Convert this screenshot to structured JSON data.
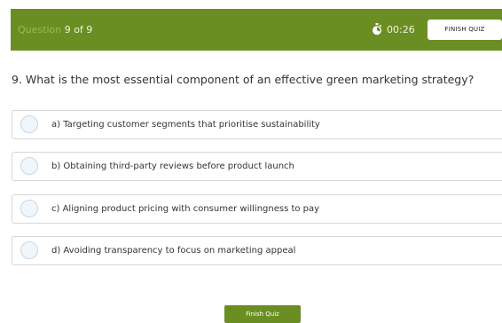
{
  "header": {
    "question_label": "Question",
    "question_number": "9 of 9",
    "timer": "00:26",
    "timer_icon": "stopwatch-icon",
    "finish_button": "FINISH QUIZ",
    "bar_color": "#6b8e23"
  },
  "question": {
    "text": "9. What is the most essential component of an effective green marketing strategy?"
  },
  "options": [
    {
      "text": "a) Targeting customer segments that prioritise sustainability"
    },
    {
      "text": "b) Obtaining third-party reviews before product launch"
    },
    {
      "text": "c) Aligning product pricing with consumer willingness to pay"
    },
    {
      "text": "d) Avoiding transparency to focus on marketing appeal"
    }
  ],
  "footer": {
    "finish_button": "Finish Quiz"
  }
}
